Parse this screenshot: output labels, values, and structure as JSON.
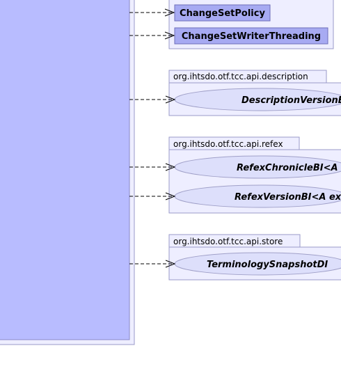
{
  "colors": {
    "package_fill": "#EEEEFF",
    "package_stroke": "#9A9AC8",
    "main_class_fill": "#B8BCFF",
    "main_class_stroke": "#8A8AC8",
    "class_fill": "#A7AAF2",
    "class_stroke": "#6E6EB8",
    "interface_fill": "#DDDFFB",
    "interface_stroke": "#A0A0C8",
    "dependency_line": "#000000"
  },
  "packages": [
    {
      "name": "",
      "elements": [
        {
          "kind": "class",
          "label": "ChangeSetPolicy"
        },
        {
          "kind": "class",
          "label": "ChangeSetWriterThreading"
        }
      ]
    },
    {
      "name": "org.ihtsdo.otf.tcc.api.description",
      "elements": [
        {
          "kind": "interface",
          "label": "DescriptionVersionBI"
        }
      ]
    },
    {
      "name": "org.ihtsdo.otf.tcc.api.refex",
      "elements": [
        {
          "kind": "interface",
          "label": "RefexChronicleBI<A"
        },
        {
          "kind": "interface",
          "label": "RefexVersionBI<A ex"
        }
      ]
    },
    {
      "name": "org.ihtsdo.otf.tcc.api.store",
      "elements": [
        {
          "kind": "interface",
          "label": "TerminologySnapshotDI"
        }
      ]
    }
  ],
  "dependency_style": "dashed-open-arrow"
}
